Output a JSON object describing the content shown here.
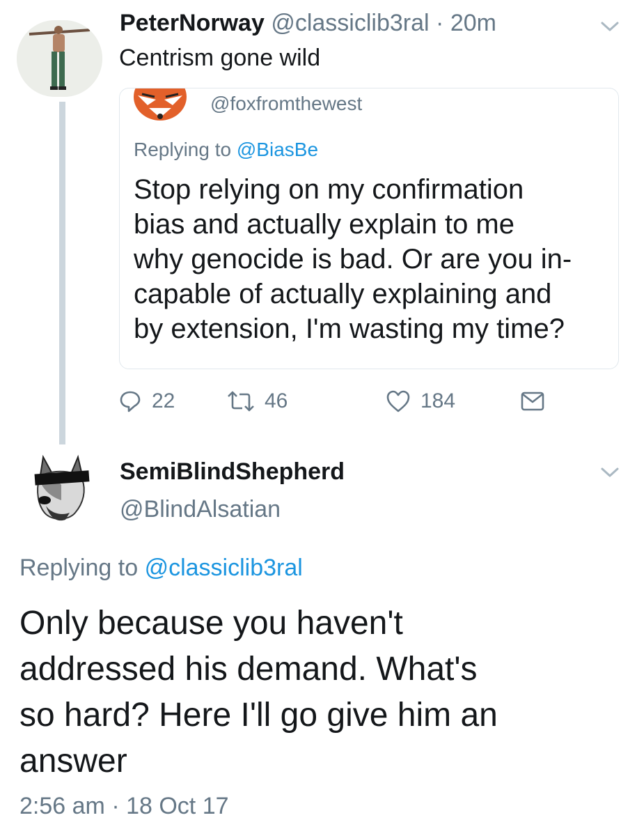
{
  "tweet": {
    "display_name": "PeterNorway",
    "handle": "@classiclib3ral",
    "separator": "·",
    "time": "20m",
    "text": "Centrism gone wild",
    "quoted": {
      "handle": "@foxfromthewest",
      "replying_prefix": "Replying to",
      "replying_to": "@BiasBe",
      "lines": [
        "Stop relying on my confirmation",
        "bias and actually explain to me",
        "why genocide is bad. Or are you in-",
        "capable of actually explaining and",
        "by extension, I'm wasting my time?"
      ]
    },
    "actions": {
      "replies": "22",
      "retweets": "46",
      "likes": "184"
    }
  },
  "reply": {
    "display_name": "SemiBlindShepherd",
    "handle": "@BlindAlsatian",
    "replying_prefix": "Replying to",
    "replying_to": "@classiclib3ral",
    "lines": [
      "Only because you haven't",
      "addressed his demand. What's",
      "so hard? Here I'll go give him an",
      "answer"
    ],
    "time": "2:56 am",
    "separator": "·",
    "date": "18 Oct 17"
  },
  "icons": {
    "reply": "reply-icon",
    "retweet": "retweet-icon",
    "like": "heart-icon",
    "dm": "envelope-icon",
    "more": "chevron-down-icon"
  },
  "colors": {
    "link_blue": "#1b95e0",
    "meta_gray": "#657786",
    "thread_line": "#ccd6dd"
  }
}
